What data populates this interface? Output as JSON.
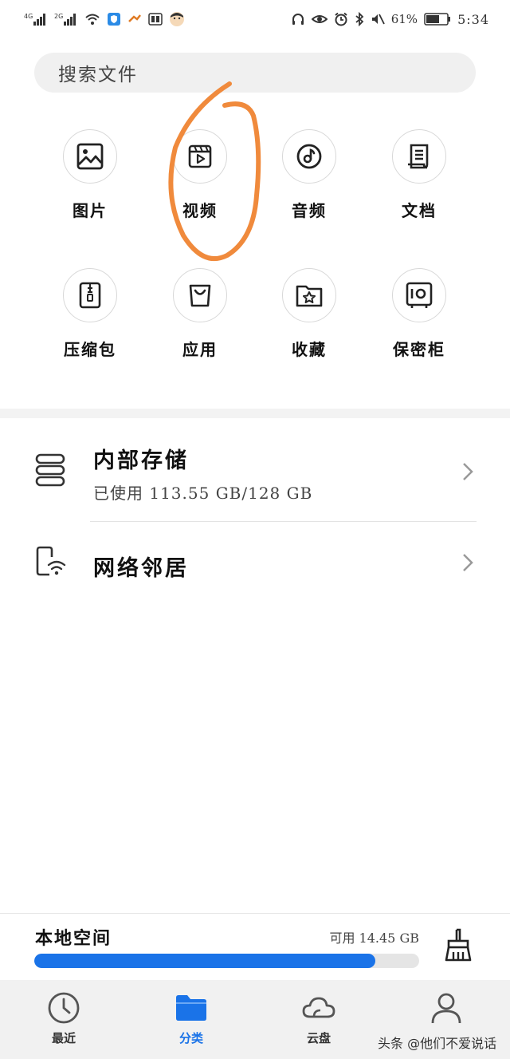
{
  "status_bar": {
    "signal1": "4G",
    "signal2": "2G",
    "battery": "61%",
    "time": "5:34"
  },
  "search": {
    "placeholder": "搜索文件"
  },
  "categories": [
    {
      "label": "图片",
      "icon": "image-icon"
    },
    {
      "label": "视频",
      "icon": "video-icon"
    },
    {
      "label": "音频",
      "icon": "music-disc-icon"
    },
    {
      "label": "文档",
      "icon": "document-icon"
    },
    {
      "label": "压缩包",
      "icon": "zip-icon"
    },
    {
      "label": "应用",
      "icon": "shopping-bag-icon"
    },
    {
      "label": "收藏",
      "icon": "star-folder-icon"
    },
    {
      "label": "保密柜",
      "icon": "safe-icon"
    }
  ],
  "storage": {
    "internal_title": "内部存储",
    "internal_usage": "已使用 113.55 GB/128 GB",
    "network_title": "网络邻居"
  },
  "local_space": {
    "title": "本地空间",
    "free": "可用 14.45 GB",
    "used_fraction": 0.887
  },
  "tabs": [
    {
      "label": "最近",
      "icon": "clock-icon"
    },
    {
      "label": "分类",
      "icon": "folder-icon"
    },
    {
      "label": "云盘",
      "icon": "cloud-icon"
    },
    {
      "label": "",
      "icon": "user-icon"
    }
  ],
  "watermark": "头条 @他们不爱说话",
  "colors": {
    "accent": "#1a73e8",
    "annotation": "#f08a3c"
  }
}
